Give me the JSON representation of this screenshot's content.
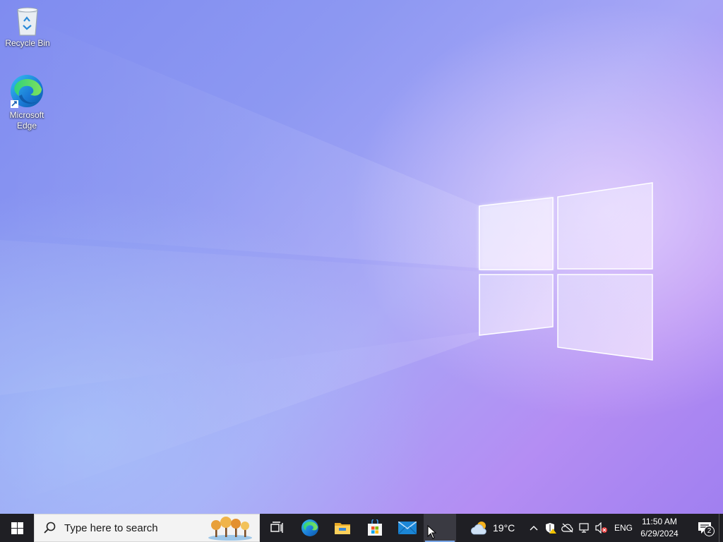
{
  "desktop": {
    "icons": [
      {
        "label": "Recycle Bin",
        "icon": "recycle-bin-icon"
      },
      {
        "label": "Microsoft Edge",
        "icon": "edge-icon"
      }
    ]
  },
  "taskbar": {
    "search_placeholder": "Type here to search",
    "pinned": [
      "task-view-icon",
      "edge-icon",
      "file-explorer-icon",
      "microsoft-store-icon",
      "mail-icon",
      "active-app"
    ],
    "weather": {
      "temp": "19°C",
      "icon": "partly-cloudy-icon"
    },
    "tray": {
      "language": "ENG",
      "time": "11:50 AM",
      "date": "6/29/2024",
      "notification_count": "2"
    }
  },
  "colors": {
    "taskbar_bg": "#1f1f24",
    "accent": "#7aa7e8",
    "wallpaper_left": "#7f8cf0",
    "wallpaper_right": "#b48df3"
  }
}
